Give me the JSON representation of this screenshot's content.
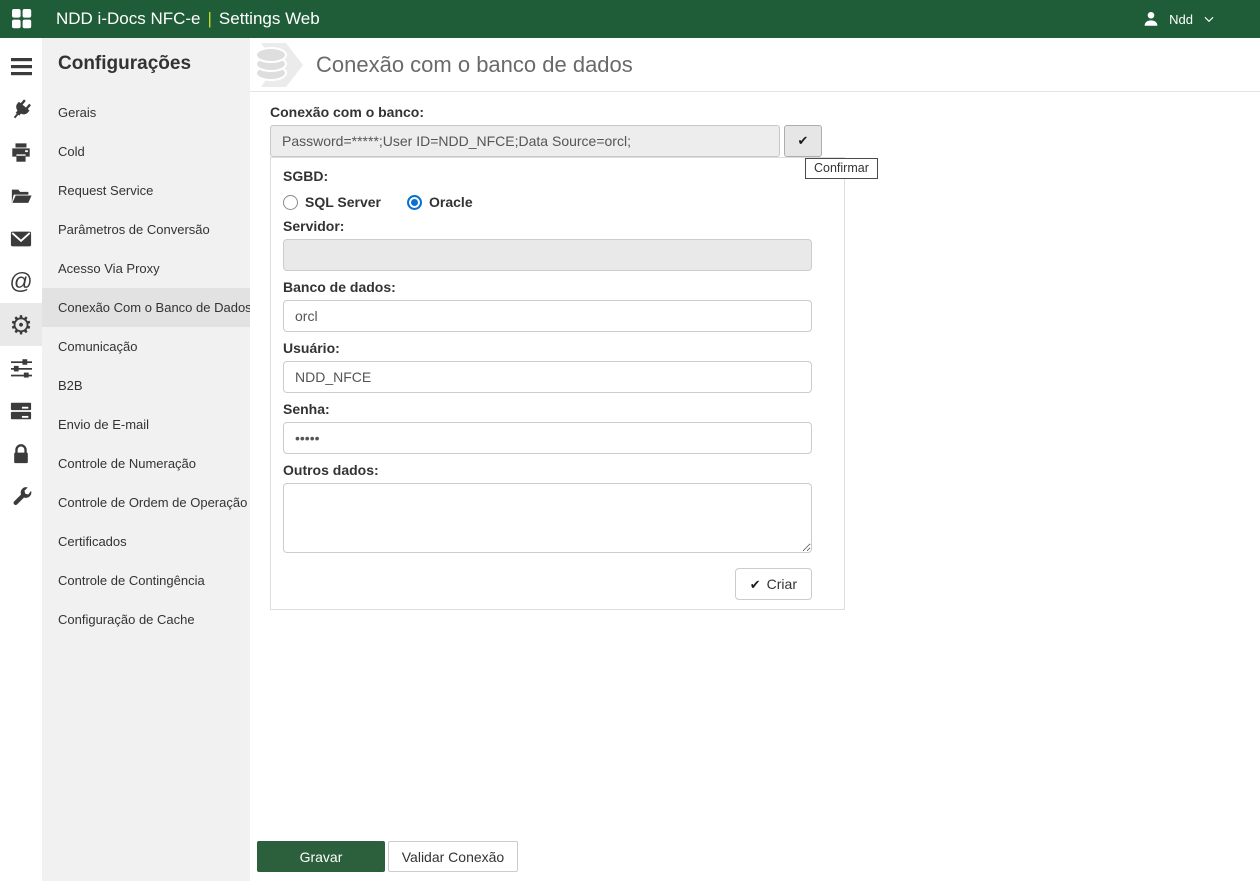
{
  "header": {
    "title_left": "NDD i-Docs NFC-e",
    "separator": "|",
    "title_right": "Settings Web",
    "user_name": "Ndd"
  },
  "glyphs": {
    "check": "✔",
    "at": "@",
    "gear": "⚙"
  },
  "icon_rail": {
    "icons": [
      "menu",
      "plug",
      "printer",
      "folder-open",
      "envelope",
      "at-sign",
      "gear",
      "sliders",
      "server",
      "lock",
      "wrench"
    ],
    "active_icon": "gear"
  },
  "sidebar": {
    "title": "Configurações",
    "selected_item": "Conexão Com o Banco de Dados",
    "items": [
      "Gerais",
      "Cold",
      "Request Service",
      "Parâmetros de Conversão",
      "Acesso Via Proxy",
      "Conexão Com o Banco de Dados",
      "Comunicação",
      "B2B",
      "Envio de E-mail",
      "Controle de Numeração",
      "Controle de Ordem de Operação",
      "Certificados",
      "Controle de Contingência",
      "Configuração de Cache"
    ]
  },
  "main": {
    "page_title": "Conexão com o banco de dados",
    "connection": {
      "label": "Conexão com o banco:",
      "value": "Password=*****;User ID=NDD_NFCE;Data Source=orcl;",
      "confirm_tooltip": "Confirmar"
    },
    "form": {
      "sgbd_label": "SGBD:",
      "sgbd_options": [
        {
          "label": "SQL Server",
          "selected": false
        },
        {
          "label": "Oracle",
          "selected": true
        }
      ],
      "servidor_label": "Servidor:",
      "servidor_value": "",
      "banco_label": "Banco de dados:",
      "banco_value": "orcl",
      "usuario_label": "Usuário:",
      "usuario_value": "NDD_NFCE",
      "senha_label": "Senha:",
      "senha_value": "•••••",
      "outros_label": "Outros dados:",
      "outros_value": "",
      "criar_label": "Criar"
    },
    "actions": {
      "gravar_label": "Gravar",
      "validar_label": "Validar Conexão"
    }
  },
  "colors": {
    "header_green": "#1f5c38",
    "button_green": "#2c5f3c",
    "radio_blue": "#0a70cf",
    "selected_item_bg": "#e2e2e2"
  }
}
